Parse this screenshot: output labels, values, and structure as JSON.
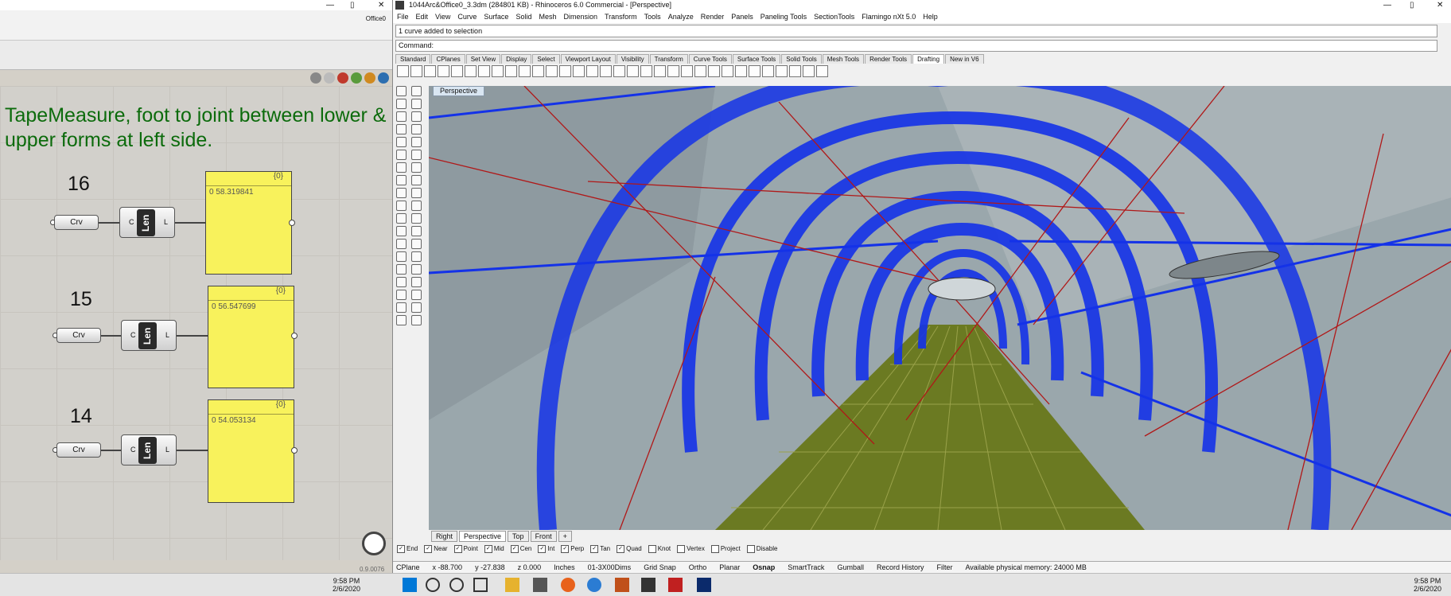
{
  "grasshopper": {
    "window_controls": {
      "minimize": "—",
      "maximize": "▯",
      "close": "✕"
    },
    "doc_name": "Office0",
    "note": "TapeMeasure, foot to joint between lower & upper forms at left side.",
    "groups": [
      {
        "number": "16",
        "input_label": "Crv",
        "len_label": "Len",
        "c": "C",
        "l": "L",
        "panel_header": "{0}",
        "panel_value": "0  58.319841"
      },
      {
        "number": "15",
        "input_label": "Crv",
        "len_label": "Len",
        "c": "C",
        "l": "L",
        "panel_header": "{0}",
        "panel_value": "0  56.547699"
      },
      {
        "number": "14",
        "input_label": "Crv",
        "len_label": "Len",
        "c": "C",
        "l": "L",
        "panel_header": "{0}",
        "panel_value": "0  54.053134"
      }
    ],
    "version": "0.9.0076"
  },
  "rhino": {
    "title": "1044Arc&Office0_3.3dm (284801 KB) - Rhinoceros 6.0 Commercial - [Perspective]",
    "window_controls": {
      "minimize": "—",
      "maximize": "▯",
      "close": "✕"
    },
    "menu": [
      "File",
      "Edit",
      "View",
      "Curve",
      "Surface",
      "Solid",
      "Mesh",
      "Dimension",
      "Transform",
      "Tools",
      "Analyze",
      "Render",
      "Panels",
      "Paneling Tools",
      "SectionTools",
      "Flamingo nXt 5.0",
      "Help"
    ],
    "command_history": "1 curve added to selection",
    "command_prompt": "Command:",
    "tabs": [
      "Standard",
      "CPlanes",
      "Set View",
      "Display",
      "Select",
      "Viewport Layout",
      "Visibility",
      "Transform",
      "Curve Tools",
      "Surface Tools",
      "Solid Tools",
      "Mesh Tools",
      "Render Tools",
      "Drafting",
      "New in V6"
    ],
    "active_tab": "Drafting",
    "viewport_label": "Perspective",
    "viewport_tabs": [
      "Right",
      "Perspective",
      "Top",
      "Front",
      "+"
    ],
    "active_viewport_tab": "Perspective",
    "osnaps": [
      {
        "label": "End",
        "on": true
      },
      {
        "label": "Near",
        "on": true
      },
      {
        "label": "Point",
        "on": true
      },
      {
        "label": "Mid",
        "on": true
      },
      {
        "label": "Cen",
        "on": true
      },
      {
        "label": "Int",
        "on": true
      },
      {
        "label": "Perp",
        "on": true
      },
      {
        "label": "Tan",
        "on": true
      },
      {
        "label": "Quad",
        "on": true
      },
      {
        "label": "Knot",
        "on": false
      },
      {
        "label": "Vertex",
        "on": false
      },
      {
        "label": "Project",
        "on": false
      },
      {
        "label": "Disable",
        "on": false
      }
    ],
    "status": {
      "cplane": "CPlane",
      "x": "x -88.700",
      "y": "y -27.838",
      "z": "z 0.000",
      "units": "Inches",
      "layer": "01-3X00Dims",
      "grid_snap": "Grid Snap",
      "ortho": "Ortho",
      "planar": "Planar",
      "osnap": "Osnap",
      "smarttrack": "SmartTrack",
      "gumball": "Gumball",
      "record_history": "Record History",
      "filter": "Filter",
      "memory": "Available physical memory: 24000 MB"
    },
    "colors": {
      "frame_blue": "#1432e8",
      "floor": "#6b7a22",
      "red_lines": "#b01818",
      "sky": "#9aa7ac"
    }
  },
  "taskbar": {
    "time": "9:58 PM",
    "date": "2/6/2020"
  }
}
